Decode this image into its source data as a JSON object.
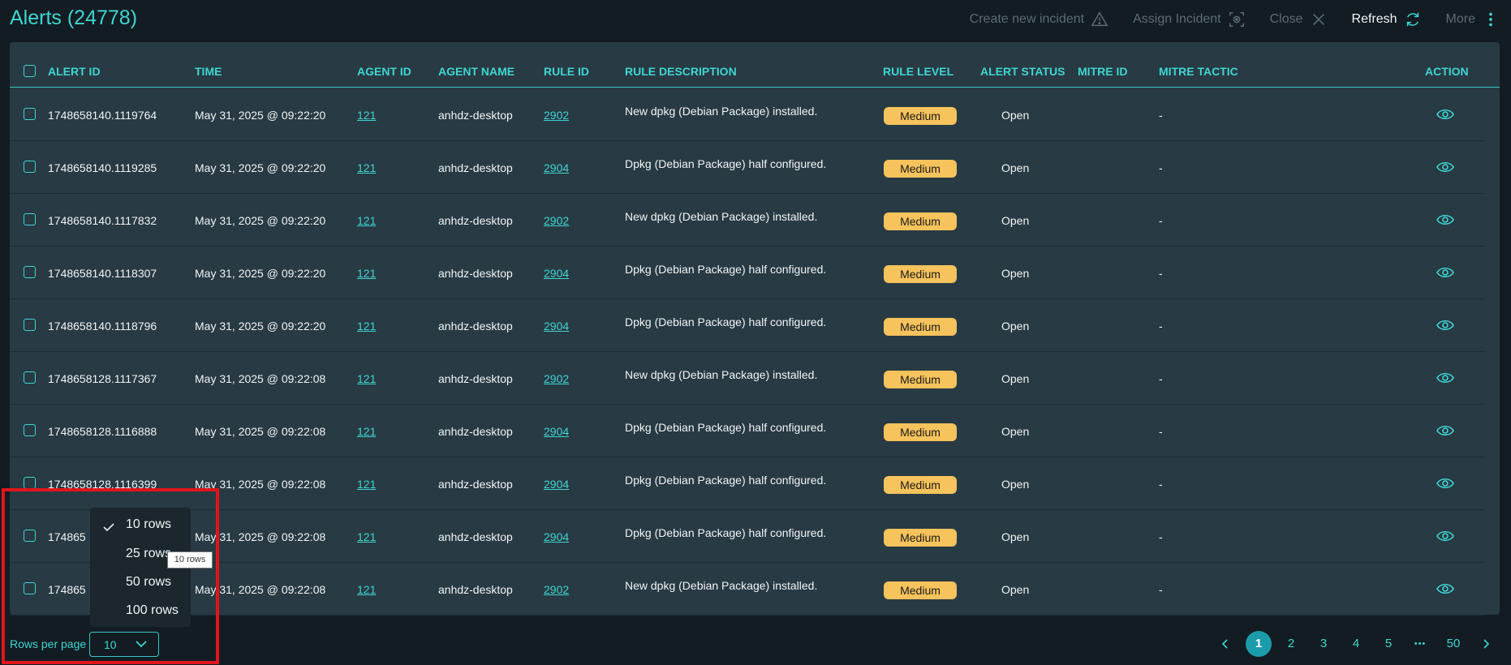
{
  "header": {
    "title": "Alerts (24778)",
    "actions": {
      "create_incident": "Create new incident",
      "assign_incident": "Assign Incident",
      "close": "Close",
      "refresh": "Refresh",
      "more": "More"
    }
  },
  "table": {
    "columns": [
      "ALERT ID",
      "TIME",
      "AGENT ID",
      "AGENT NAME",
      "RULE ID",
      "RULE DESCRIPTION",
      "RULE LEVEL",
      "ALERT STATUS",
      "MITRE ID",
      "MITRE TACTIC",
      "ACTION"
    ],
    "rows": [
      {
        "alert_id": "1748658140.1119764",
        "time": "May 31, 2025 @ 09:22:20",
        "agent_id": "121",
        "agent_name": "anhdz-desktop",
        "rule_id": "2902",
        "rule_description": "New dpkg (Debian Package) installed.",
        "rule_level": "Medium",
        "alert_status": "Open",
        "mitre_id": "",
        "mitre_tactic": "-"
      },
      {
        "alert_id": "1748658140.1119285",
        "time": "May 31, 2025 @ 09:22:20",
        "agent_id": "121",
        "agent_name": "anhdz-desktop",
        "rule_id": "2904",
        "rule_description": "Dpkg (Debian Package) half configured.",
        "rule_level": "Medium",
        "alert_status": "Open",
        "mitre_id": "",
        "mitre_tactic": "-"
      },
      {
        "alert_id": "1748658140.1117832",
        "time": "May 31, 2025 @ 09:22:20",
        "agent_id": "121",
        "agent_name": "anhdz-desktop",
        "rule_id": "2902",
        "rule_description": "New dpkg (Debian Package) installed.",
        "rule_level": "Medium",
        "alert_status": "Open",
        "mitre_id": "",
        "mitre_tactic": "-"
      },
      {
        "alert_id": "1748658140.1118307",
        "time": "May 31, 2025 @ 09:22:20",
        "agent_id": "121",
        "agent_name": "anhdz-desktop",
        "rule_id": "2904",
        "rule_description": "Dpkg (Debian Package) half configured.",
        "rule_level": "Medium",
        "alert_status": "Open",
        "mitre_id": "",
        "mitre_tactic": "-"
      },
      {
        "alert_id": "1748658140.1118796",
        "time": "May 31, 2025 @ 09:22:20",
        "agent_id": "121",
        "agent_name": "anhdz-desktop",
        "rule_id": "2904",
        "rule_description": "Dpkg (Debian Package) half configured.",
        "rule_level": "Medium",
        "alert_status": "Open",
        "mitre_id": "",
        "mitre_tactic": "-"
      },
      {
        "alert_id": "1748658128.1117367",
        "time": "May 31, 2025 @ 09:22:08",
        "agent_id": "121",
        "agent_name": "anhdz-desktop",
        "rule_id": "2902",
        "rule_description": "New dpkg (Debian Package) installed.",
        "rule_level": "Medium",
        "alert_status": "Open",
        "mitre_id": "",
        "mitre_tactic": "-"
      },
      {
        "alert_id": "1748658128.1116888",
        "time": "May 31, 2025 @ 09:22:08",
        "agent_id": "121",
        "agent_name": "anhdz-desktop",
        "rule_id": "2904",
        "rule_description": "Dpkg (Debian Package) half configured.",
        "rule_level": "Medium",
        "alert_status": "Open",
        "mitre_id": "",
        "mitre_tactic": "-"
      },
      {
        "alert_id": "1748658128.1116399",
        "time": "May 31, 2025 @ 09:22:08",
        "agent_id": "121",
        "agent_name": "anhdz-desktop",
        "rule_id": "2904",
        "rule_description": "Dpkg (Debian Package) half configured.",
        "rule_level": "Medium",
        "alert_status": "Open",
        "mitre_id": "",
        "mitre_tactic": "-"
      },
      {
        "alert_id": "174865",
        "time": "May 31, 2025 @ 09:22:08",
        "agent_id": "121",
        "agent_name": "anhdz-desktop",
        "rule_id": "2904",
        "rule_description": "Dpkg (Debian Package) half configured.",
        "rule_level": "Medium",
        "alert_status": "Open",
        "mitre_id": "",
        "mitre_tactic": "-"
      },
      {
        "alert_id": "174865",
        "time": "May 31, 2025 @ 09:22:08",
        "agent_id": "121",
        "agent_name": "anhdz-desktop",
        "rule_id": "2902",
        "rule_description": "New dpkg (Debian Package) installed.",
        "rule_level": "Medium",
        "alert_status": "Open",
        "mitre_id": "",
        "mitre_tactic": "-"
      }
    ]
  },
  "footer": {
    "rows_per_page_label": "Rows per page",
    "rows_per_page_value": "10",
    "menu_options": [
      "10 rows",
      "25 rows",
      "50 rows",
      "100 rows"
    ],
    "menu_selected": "10 rows",
    "tooltip": "10 rows",
    "pages": [
      "1",
      "2",
      "3",
      "4",
      "5",
      "50"
    ],
    "current_page": "1",
    "ellipsis": "•••"
  },
  "colors": {
    "accent": "#3fd6d2",
    "badge_medium": "#f7c35c",
    "highlight": "#e1151b",
    "current_page": "#1c9cab"
  }
}
